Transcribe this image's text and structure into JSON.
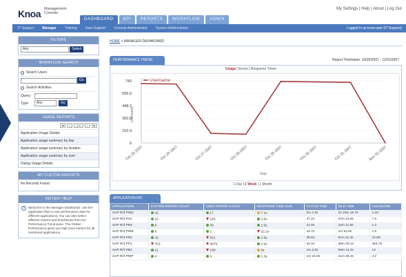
{
  "colors": {
    "brand": "#1f3f7a",
    "nav_blue": "#4b79bd",
    "series": "#a33a3a",
    "ok": "#5aa032",
    "warn": "#e0b020",
    "bad": "#c0281e"
  },
  "header": {
    "logo": "Knoa",
    "logo_sub_1": "Management",
    "logo_sub_2": "Console",
    "top_links": "My Settings | Help | About | Log Out",
    "tabs": [
      "DASHBOARD",
      "KPI",
      "REPORTS",
      "WORKFLOW",
      "ADMIN"
    ]
  },
  "subnav": {
    "items": [
      "IT Support",
      "Manager",
      "Training",
      "User Support",
      "Console Administrator",
      "System Administrator"
    ],
    "logged_in": "Logged in as knoa user (IT Support)"
  },
  "filters": {
    "title": "FILTERS",
    "select_value": "Any",
    "select_button": "Select"
  },
  "workflow_search": {
    "title": "WORKFLOW SEARCH",
    "search_users": "Search Users",
    "go": "Go",
    "search_activities": "Search Activities",
    "query_label": "Query:",
    "type_label": "Type:",
    "type_value": "Any",
    "go2": "Go"
  },
  "usage_reports": {
    "title": "USAGE REPORTS",
    "pager": [
      "◄",
      "‹",
      "1 2",
      "›",
      "►"
    ],
    "items": [
      "Application Usage Details",
      "Application usage summary by day",
      "Application usage summary by location",
      "Application usage summary by user",
      "Dialog Usage Details"
    ]
  },
  "custom_reports": {
    "title": "MY CUSTOM REPORTS",
    "empty": "No Records Found"
  },
  "instant_help": {
    "title": "INSTANT HELP",
    "icon": "?",
    "text": "Welcome to the Manager Dashboard. Use the application filter to see performance data for different applications. You can also select different metrics and timeframes from the Performance Trend pane. The Global Performance gives you high level metrics for all monitored applications."
  },
  "breadcrumb": {
    "home": "HOME",
    "rest": " > MANAGER DASHBOARD"
  },
  "performance": {
    "tab": "PERFORMANCE TREND",
    "report_timeframe": "Report Timeframe:  10/25/2007 - 11/01/2007",
    "metric_on": "Usage",
    "metric_rest": " | Errors | Response Times",
    "period_pre": "1 Day | ",
    "period_on": "1 Week",
    "period_post": " | 1 Month"
  },
  "chart_data": {
    "type": "line",
    "title": "",
    "xlabel": "Day",
    "ylabel": "Username",
    "legend": "Username",
    "x": [
      "Oct 25 2007",
      "Oct 26 2007",
      "Oct 27 2007",
      "Oct 28 2007",
      "Oct 29 2007",
      "Oct 30 2007",
      "Oct 31 2007",
      "Nov 01 2007"
    ],
    "y_ticks": [
      "743",
      "595.6",
      "448.2",
      "300.8",
      "153.4",
      "6"
    ],
    "ylim": [
      6,
      743
    ],
    "series": [
      {
        "name": "Username",
        "values": [
          710,
          705,
          120,
          110,
          735,
          730,
          725,
          6
        ]
      }
    ]
  },
  "kpi": {
    "tab": "APPLICATION KPI",
    "columns": [
      "APPLICATION",
      "SYSTEM ERROR COUNT",
      "USER ERROR COUNT",
      "RESPONSE TIME SUM",
      "ACTIVE TIME",
      "IDLE TIME",
      "USERNAME"
    ],
    "rows": [
      {
        "app": "SAP R/3 PWD",
        "sys": "10",
        "sys_s": "ok",
        "usr": "17",
        "usr_s": "ok",
        "resp": "7.1s",
        "resp_s": "warn",
        "active": "2m 4.3s",
        "idle": "1h 16m 16.7s",
        "user": "1.33"
      },
      {
        "app": "SAP R/3 PS1",
        "sys": "23",
        "sys_s": "ok",
        "usr": "183",
        "usr_s": "bad",
        "resp": "2.6s",
        "resp_s": "ok",
        "active": "37.2s",
        "idle": "37m 15.9s",
        "user": "7.6"
      },
      {
        "app": "SAP R/3 PR2",
        "sys": "8",
        "sys_s": "ok",
        "usr": "39",
        "usr_s": "ok",
        "resp": "2.5s",
        "resp_s": "ok",
        "active": "21.9s",
        "idle": "24m 11.8s",
        "user": "1.2"
      },
      {
        "app": "SAP R/3 PWB",
        "sys": "8",
        "sys_s": "ok",
        "usr": "1",
        "usr_s": "ok",
        "resp": "22.2s",
        "resp_s": "bad",
        "active": "43.7s",
        "idle": "1m 51.8s",
        "user": "1.5"
      },
      {
        "app": "SAP R/3 PD1",
        "sys": "32",
        "sys_s": "ok",
        "usr": "541",
        "usr_s": "bad",
        "resp": "2.5s",
        "resp_s": "ok",
        "active": "28.5s",
        "idle": "51m 11.3s",
        "user": "12.86"
      },
      {
        "app": "SAP R/3 PP1",
        "sys": "763",
        "sys_s": "bad",
        "usr": "6679",
        "usr_s": "bad",
        "resp": "2.6s",
        "resp_s": "ok",
        "active": "34.4s",
        "idle": "38m 20.1s",
        "user": "454.75"
      },
      {
        "app": "SAP R/3 PB1",
        "sys": "21",
        "sys_s": "ok",
        "usr": "180",
        "usr_s": "bad",
        "resp": "5s",
        "resp_s": "warn",
        "active": "1m 2.9s",
        "idle": "50m 14.2s",
        "user": "13"
      },
      {
        "app": "SAP R/3 PWP",
        "sys": "4",
        "sys_s": "ok",
        "usr": "6",
        "usr_s": "ok",
        "resp": "1.3s",
        "resp_s": "ok",
        "active": "1m 44.5s",
        "idle": "21m 38.4s",
        "user": "4.2"
      }
    ]
  }
}
